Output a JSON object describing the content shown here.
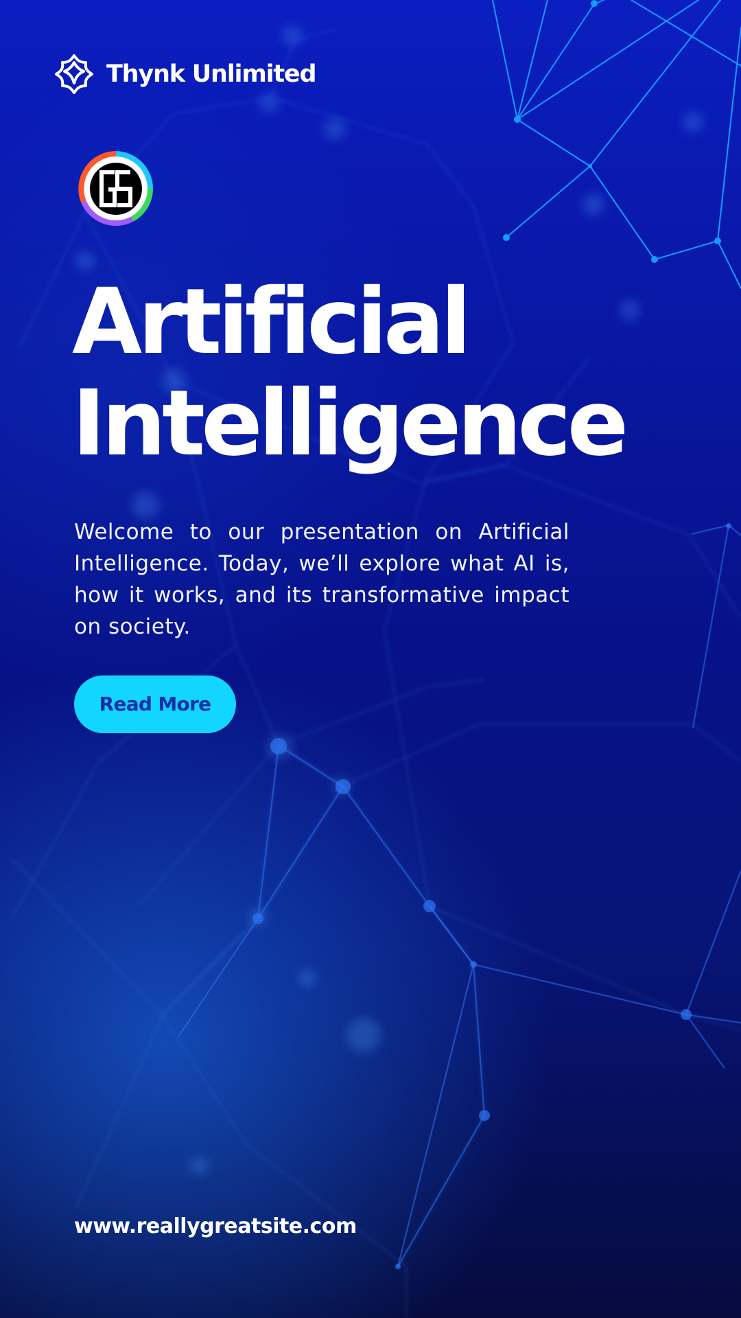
{
  "brand": {
    "name": "Thynk Unlimited",
    "icon": "asterisk-flower-icon"
  },
  "emblem": {
    "text": "GS",
    "ring_colors": [
      "#ff5a2a",
      "#1ec7ff",
      "#39d95d",
      "#a15cff"
    ]
  },
  "hero": {
    "title_line_1": "Artificial",
    "title_line_2": "Intelligence",
    "description": "Welcome to our presentation on Artificial Intelligence. Today, we’ll explore what AI is, how it works, and its transformative impact on society."
  },
  "cta": {
    "label": "Read More"
  },
  "footer": {
    "website": "www.reallygreatsite.com"
  },
  "colors": {
    "background_top": "#0b1ec0",
    "background_mid": "#07128a",
    "background_bottom": "#060b3e",
    "button": "#12d6ff",
    "button_text": "#1330a8",
    "network_line": "#1a8cff"
  }
}
